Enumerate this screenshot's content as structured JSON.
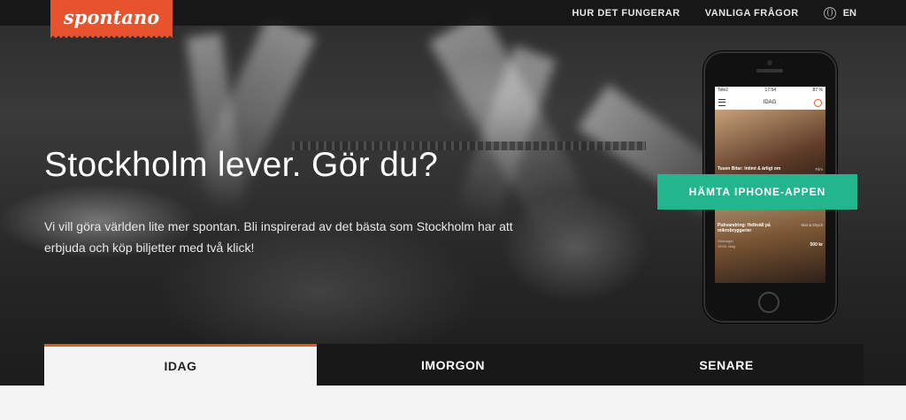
{
  "brand": {
    "name": "spontano",
    "color": "#e8532e"
  },
  "nav": {
    "items": [
      "HUR DET FUNGERAR",
      "VANLIGA FRÅGOR"
    ],
    "lang_icon": "globe-icon",
    "lang_label": "EN"
  },
  "hero": {
    "headline": "Stockholm lever. Gör du?",
    "lede": "Vi vill göra världen lite mer spontan. Bli inspirerad av det bästa som Stockholm har att erbjuda och köp biljetter med två klick!",
    "cta_label": "HÄMTA IPHONE-APPEN",
    "cta_color": "#22b58e"
  },
  "phone": {
    "carrier": "Tele2",
    "time": "17:54",
    "battery": "87 %",
    "header": "IDAG",
    "cards": [
      {
        "title": "Tusen Bitar: Intimt & ärligt om",
        "category": "Film"
      },
      {
        "title": "Pubvandring: Helkväll på mikrobryggerier",
        "category": "Mat & Dryck",
        "venue": "Stortorget",
        "date": "19:00, idag",
        "price": "500 kr"
      }
    ]
  },
  "tabs": [
    {
      "label": "IDAG",
      "active": true
    },
    {
      "label": "IMORGON",
      "active": false
    },
    {
      "label": "SENARE",
      "active": false
    }
  ]
}
